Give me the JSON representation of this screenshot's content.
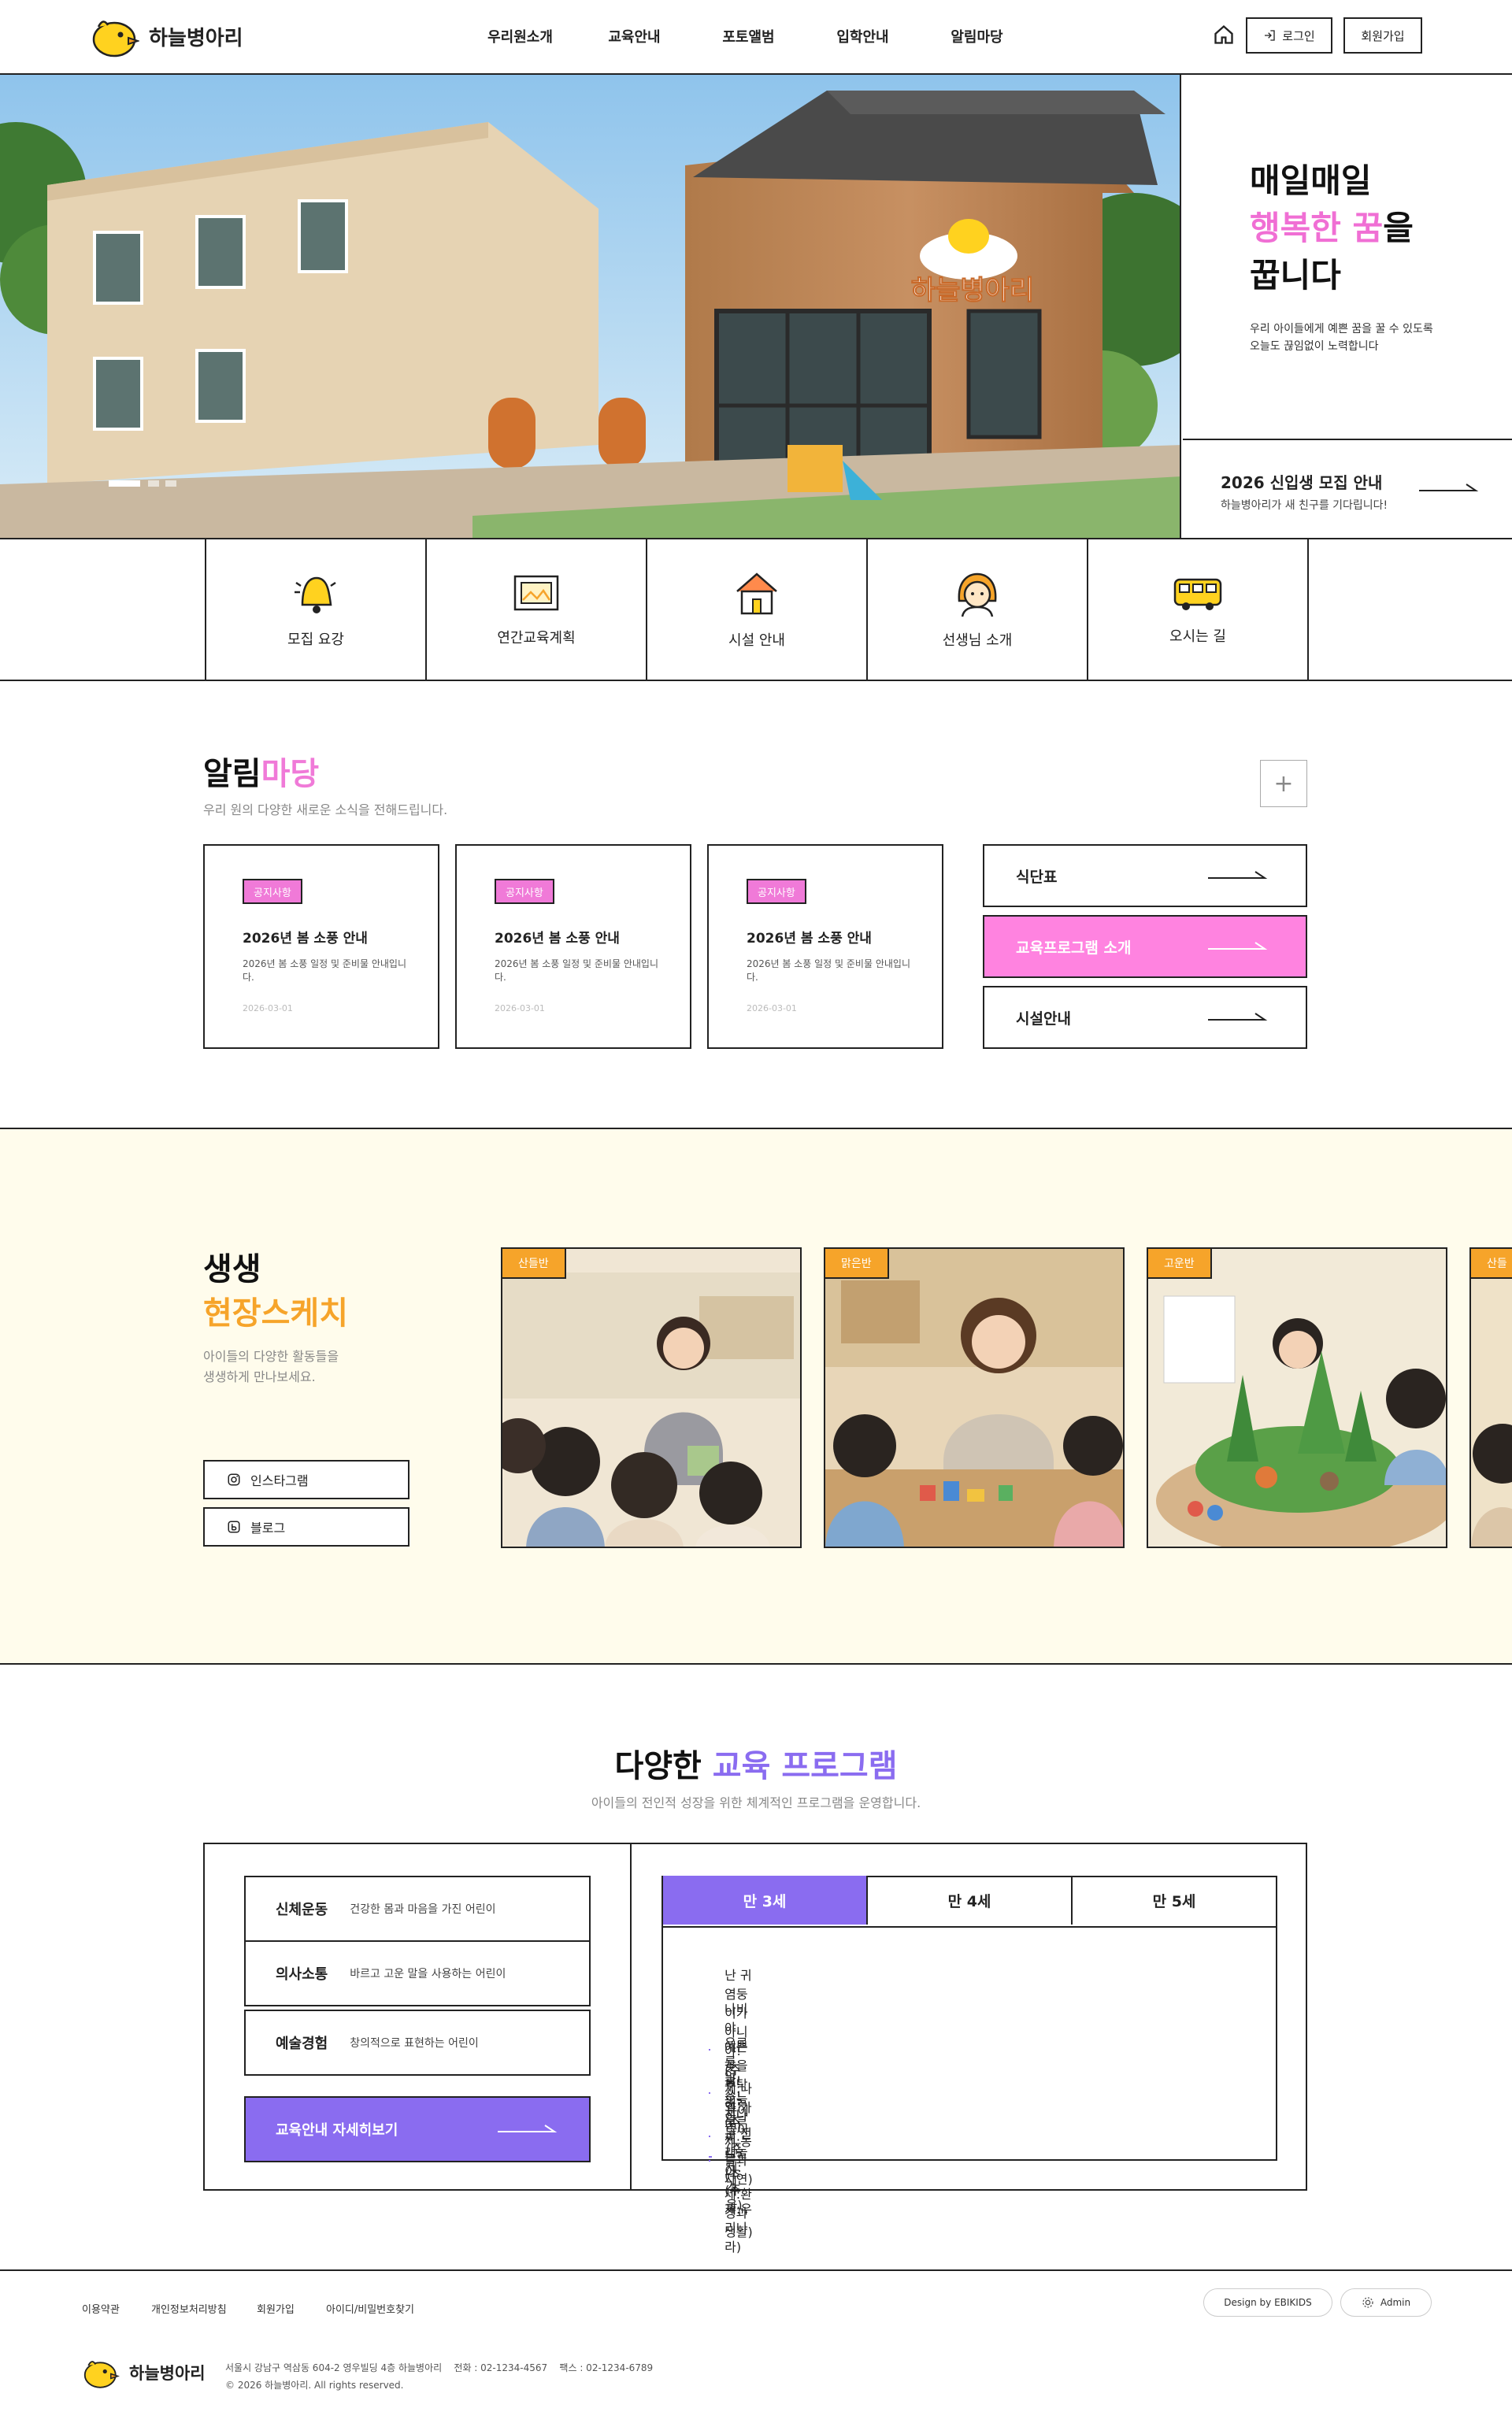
{
  "header": {
    "logo_text": "하늘병아리",
    "nav": [
      "우리원소개",
      "교육안내",
      "포토앨범",
      "입학안내",
      "알림마당"
    ],
    "login_label": "로그인",
    "signup_label": "회원가입"
  },
  "hero": {
    "sign_text": "하늘병아리",
    "title_line1": "매일매일",
    "title_line2_accent": "행복한 꿈",
    "title_line2_rest": "을",
    "title_line3": "꿉니다",
    "desc_line1": "우리 아이들에게 예쁜 꿈을 꿀 수 있도록",
    "desc_line2": "오늘도 끊임없이 노력합니다",
    "recruit_title": "2026 신입생 모집 안내",
    "recruit_desc": "하늘병아리가 새 친구를 기다립니다!"
  },
  "quick": [
    {
      "label": "모집 요강",
      "icon": "bell-icon"
    },
    {
      "label": "연간교육계획",
      "icon": "picture-frame-icon"
    },
    {
      "label": "시설 안내",
      "icon": "house-icon"
    },
    {
      "label": "선생님 소개",
      "icon": "teacher-icon"
    },
    {
      "label": "오시는 길",
      "icon": "bus-icon"
    }
  ],
  "notice": {
    "title_a": "알림",
    "title_b": "마당",
    "subtitle": "우리 원의 다양한 새로운 소식을 전해드립니다.",
    "more": "+",
    "cards": [
      {
        "tag": "공지사항",
        "title": "2026년 봄 소풍 안내",
        "desc": "2026년 봄 소풍 일정 및 준비물 안내입니다.",
        "date": "2026-03-01"
      },
      {
        "tag": "공지사항",
        "title": "2026년 봄 소풍 안내",
        "desc": "2026년 봄 소풍 일정 및 준비물 안내입니다.",
        "date": "2026-03-01"
      },
      {
        "tag": "공지사항",
        "title": "2026년 봄 소풍 안내",
        "desc": "2026년 봄 소풍 일정 및 준비물 안내입니다.",
        "date": "2026-03-01"
      }
    ],
    "links": [
      {
        "label": "식단표",
        "active": false
      },
      {
        "label": "교육프로그램 소개",
        "active": true
      },
      {
        "label": "시설안내",
        "active": false
      }
    ],
    "accent_color": "#f07ad8"
  },
  "sketch": {
    "title_a": "생생",
    "title_b": "현장스케치",
    "desc_line1": "아이들의 다양한 활동들을",
    "desc_line2": "생생하게 만나보세요.",
    "instagram_label": "인스타그램",
    "blog_label": "블로그",
    "photos": [
      {
        "tag": "산들반"
      },
      {
        "tag": "맑은반"
      },
      {
        "tag": "고운반"
      },
      {
        "tag": "산들"
      }
    ],
    "accent_color": "#f6a42a"
  },
  "program": {
    "title_a": "다양한",
    "title_b": "교육 프로그램",
    "subtitle": "아이들의 전인적 성장을 위한 체계적인 프로그램을 운영합니다.",
    "items": [
      {
        "name": "신체운동",
        "desc": "건강한 몸과 마음을 가진 어린이"
      },
      {
        "name": "의사소통",
        "desc": "바르고 고운 말을 사용하는 어린이"
      },
      {
        "name": "예술경험",
        "desc": "창의적으로 표현하는 어린이"
      }
    ],
    "detail_button": "교육안내 자세히보기",
    "tabs": [
      "만 3세",
      "만 4세",
      "만 5세"
    ],
    "active_tab": 0,
    "list": [
      "난 귀염둥이가 아니야! (주제:나와 가족)",
      "나비야, 예쁜꽃을 부탁해? (주제:동물과자연)",
      "우르릉 쾅! 오늘의날씨는? (주제:환경과생활)",
      "얼쑤! 신나는 전래놀이 (주제:우리나라)",
      "눈이 좋아 (주제:겨울)"
    ],
    "accent_color": "#8a6cf0"
  },
  "footer": {
    "links": [
      "이용약관",
      "개인정보처리방침",
      "회원가입",
      "아이디/비밀번호찾기"
    ],
    "design_by": "Design by EBIKIDS",
    "admin": "Admin",
    "logo_text": "하늘병아리",
    "address": "서울시 강남구 역삼동 604-2 영우빌딩 4층 하늘병아리    전화 : 02-1234-4567    팩스 : 02-1234-6789",
    "copyright": "© 2026 하늘병아리. All rights reserved."
  }
}
